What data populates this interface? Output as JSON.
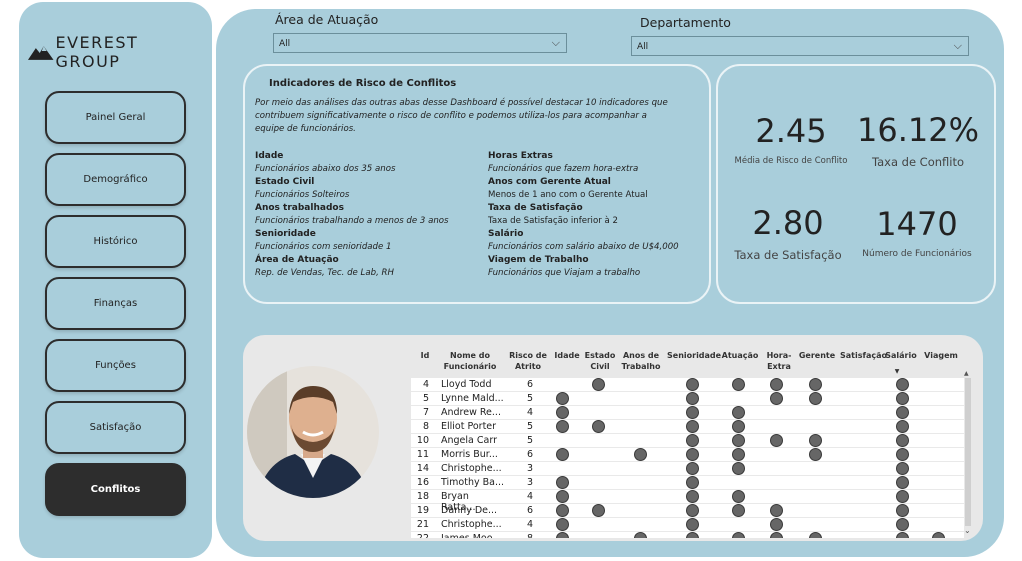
{
  "brand": {
    "name": "EVEREST GROUP"
  },
  "nav": [
    {
      "label": "Painel Geral",
      "active": false
    },
    {
      "label": "Demográfico",
      "active": false
    },
    {
      "label": "Histórico",
      "active": false
    },
    {
      "label": "Finanças",
      "active": false
    },
    {
      "label": "Funções",
      "active": false
    },
    {
      "label": "Satisfação",
      "active": false
    },
    {
      "label": "Conflitos",
      "active": true
    }
  ],
  "filters": {
    "area": {
      "label": "Área de Atuação",
      "value": "All"
    },
    "departamento": {
      "label": "Departamento",
      "value": "All"
    }
  },
  "indicators": {
    "title": "Indicadores de Risco de Conflitos",
    "description": "Por meio das análises das outras abas desse Dashboard é possível destacar 10 indicadores que contribuem significativamente o risco de conflito e podemos utiliza-los para acompanhar a equipe de funcionários.",
    "left": [
      {
        "name": "Idade",
        "desc": "Funcionários abaixo dos 35 anos"
      },
      {
        "name": "Estado Civil",
        "desc": "Funcionários Solteiros"
      },
      {
        "name": "Anos trabalhados",
        "desc": "Funcionários trabalhando a menos de 3 anos"
      },
      {
        "name": "Senioridade",
        "desc": "Funcionários com senioridade 1"
      },
      {
        "name": "Área de Atuação",
        "desc": "Rep. de Vendas, Tec. de Lab, RH"
      }
    ],
    "right": [
      {
        "name": "Horas Extras",
        "desc": "Funcionários que fazem hora-extra"
      },
      {
        "name": "Anos com Gerente Atual",
        "desc": "Menos de 1 ano com o Gerente Atual"
      },
      {
        "name": "Taxa de Satisfação",
        "desc": "Taxa de Satisfação inferior à 2"
      },
      {
        "name": "Salário",
        "desc": "Funcionários com salário abaixo de U$4,000"
      },
      {
        "name": "Viagem de Trabalho",
        "desc": "Funcionários que Viajam a trabalho"
      }
    ]
  },
  "kpis": [
    {
      "value": "2.45",
      "label": "Média de Risco de Conflito"
    },
    {
      "value": "16.12%",
      "label": "Taxa de Conflito"
    },
    {
      "value": "2.80",
      "label": "Taxa de Satisfação"
    },
    {
      "value": "1470",
      "label": "Número de Funcionários"
    }
  ],
  "table": {
    "columns": [
      "Id",
      "Nome do Funcionário",
      "Risco de Atrito",
      "Idade",
      "Estado Civil",
      "Anos de Trabalho",
      "Senioridade",
      "Atuação",
      "Hora-Extra",
      "Gerente",
      "Satisfação",
      "Salário",
      "Viagem"
    ],
    "rows": [
      {
        "id": "4",
        "nome": "Lloyd Todd",
        "risco": "6",
        "flags": [
          0,
          1,
          0,
          1,
          1,
          1,
          1,
          0,
          1,
          0
        ]
      },
      {
        "id": "5",
        "nome": "Lynne Mald...",
        "risco": "5",
        "flags": [
          1,
          0,
          0,
          1,
          0,
          1,
          1,
          0,
          1,
          0
        ]
      },
      {
        "id": "7",
        "nome": "Andrew Re...",
        "risco": "4",
        "flags": [
          1,
          0,
          0,
          1,
          1,
          0,
          0,
          0,
          1,
          0
        ]
      },
      {
        "id": "8",
        "nome": "Elliot Porter",
        "risco": "5",
        "flags": [
          1,
          1,
          0,
          1,
          1,
          0,
          0,
          0,
          1,
          0
        ]
      },
      {
        "id": "10",
        "nome": "Angela Carr",
        "risco": "5",
        "flags": [
          0,
          0,
          0,
          1,
          1,
          1,
          1,
          0,
          1,
          0
        ]
      },
      {
        "id": "11",
        "nome": "Morris Bur...",
        "risco": "6",
        "flags": [
          1,
          0,
          1,
          1,
          1,
          0,
          1,
          0,
          1,
          0
        ]
      },
      {
        "id": "14",
        "nome": "Christophe...",
        "risco": "3",
        "flags": [
          0,
          0,
          0,
          1,
          1,
          0,
          0,
          0,
          1,
          0
        ]
      },
      {
        "id": "16",
        "nome": "Timothy Ba...",
        "risco": "3",
        "flags": [
          1,
          0,
          0,
          1,
          0,
          0,
          0,
          0,
          1,
          0
        ]
      },
      {
        "id": "18",
        "nome": "Bryan Ratta...",
        "risco": "4",
        "flags": [
          1,
          0,
          0,
          1,
          1,
          0,
          0,
          0,
          1,
          0
        ]
      },
      {
        "id": "19",
        "nome": "Danny De...",
        "risco": "6",
        "flags": [
          1,
          1,
          0,
          1,
          1,
          1,
          0,
          0,
          1,
          0
        ]
      },
      {
        "id": "21",
        "nome": "Christophe...",
        "risco": "4",
        "flags": [
          1,
          0,
          0,
          1,
          0,
          1,
          0,
          0,
          1,
          0
        ]
      },
      {
        "id": "22",
        "nome": "James Moo...",
        "risco": "8",
        "flags": [
          1,
          0,
          1,
          1,
          1,
          1,
          1,
          0,
          1,
          1
        ]
      }
    ]
  },
  "colors": {
    "panel": "#a9cedb",
    "dark": "#2d2d2d",
    "dot": "#666666"
  }
}
